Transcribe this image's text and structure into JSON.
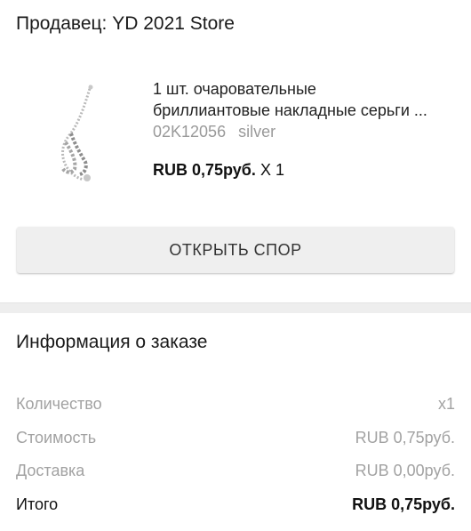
{
  "seller": {
    "label": "Продавец: YD 2021 Store"
  },
  "product": {
    "title_line1": "1 шт. очаровательные",
    "title_line2": "бриллиантовые накладные серьги ...",
    "sku": "02K12056",
    "variant": "silver",
    "price": "RUB 0,75руб.",
    "quantity": "X 1",
    "image": {
      "icon": "earring-icon",
      "color": "#9a9a9a"
    }
  },
  "dispute_button": {
    "label": "ОТКРЫТЬ СПОР"
  },
  "order_info": {
    "title": "Информация о заказе",
    "rows": [
      {
        "label": "Количество",
        "value": "x1"
      },
      {
        "label": "Стоимость",
        "value": "RUB 0,75руб."
      },
      {
        "label": "Доставка",
        "value": "RUB 0,00руб."
      },
      {
        "label": "Итого",
        "value": "RUB 0,75руб."
      }
    ]
  },
  "colors": {
    "text": "#222222",
    "muted": "#a2a2a2",
    "button_bg": "#efefef",
    "divider": "#eeeeee"
  }
}
